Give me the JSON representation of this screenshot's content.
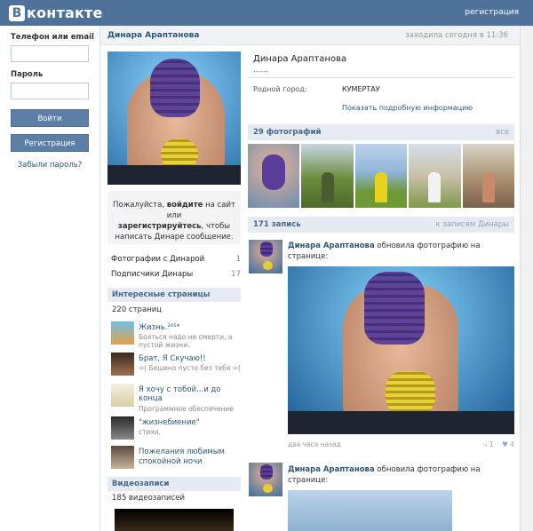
{
  "topbar": {
    "logo_letter": "В",
    "logo_text": "контакте",
    "register_link": "регистрация"
  },
  "login": {
    "phone_label": "Телефон или email",
    "password_label": "Пароль",
    "login_button": "Войти",
    "register_button": "Регистрация",
    "forgot": "Забыли пароль?"
  },
  "profile": {
    "header_name": "Динара Арaптанова",
    "status": "заходила сегодня в 11:36",
    "name": "Динара Арaптанова",
    "dots": "......",
    "hometown_label": "Родной город:",
    "hometown_value": "КУМЕРТАУ",
    "show_more": "Показать подробную информацию"
  },
  "loginbox": {
    "line1": "Пожалуйста,",
    "login_word": "войдите",
    "line1b": "на сайт или",
    "register_word": "зарегистрируйтесь",
    "line2b": ", чтобы",
    "line3": "написать Динаре сообщение."
  },
  "links": [
    {
      "label": "Фотографии с Динарой",
      "count": "1"
    },
    {
      "label": "Подписчики Динары",
      "count": "17"
    }
  ],
  "interesting": {
    "title": "Интересные страницы",
    "count": "220 страниц",
    "items": [
      {
        "title": "Жизнь.²⁰¹⁴",
        "subtitle": "Бояться надо не смерти, а пустой жизни."
      },
      {
        "title": "Брат, Я Скучаю!!",
        "subtitle": "=( Бешено пусто без тебя =("
      },
      {
        "title": "Я хочу с тобой...и до конца",
        "subtitle": "Программное обеспечение"
      },
      {
        "title": "\"жизнебиение\"",
        "subtitle": "стихи."
      },
      {
        "title": "Пожелания любимым спокойной ночи",
        "subtitle": ""
      }
    ]
  },
  "videos": {
    "title": "Видеозаписи",
    "count": "185 видеозаписей"
  },
  "photos_section": {
    "title": "29 фотографий",
    "all": "все"
  },
  "wall": {
    "title": "171 запись",
    "link": "к записям Динары"
  },
  "posts": [
    {
      "author": "Динара Арaптанова",
      "action": "обновила фотографию на странице:",
      "time": "два часа назад",
      "reposts": "1",
      "likes": "4"
    },
    {
      "author": "Динара Арaптанова",
      "action": "обновила фотографию на странице:"
    }
  ],
  "colors": {
    "topbar": "#4e729a",
    "link": "#2b587a",
    "header_bg": "#e6ebf1"
  }
}
